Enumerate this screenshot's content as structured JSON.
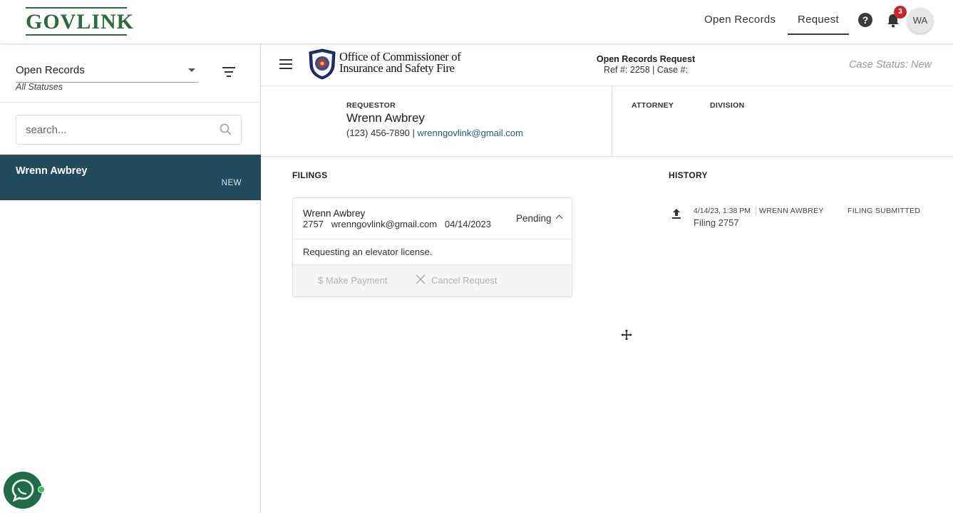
{
  "header": {
    "logo_text": "GOVLINK",
    "nav": [
      {
        "label": "Open Records"
      },
      {
        "label": "Request"
      }
    ],
    "help_icon": "help-circle-icon",
    "notifications": {
      "icon": "bell-icon",
      "count": "3"
    },
    "avatar_initials": "WA"
  },
  "sidebar": {
    "status_select": {
      "value": "Open Records",
      "sub": "All Statuses"
    },
    "search_placeholder": "search...",
    "cases": [
      {
        "name": "Wrenn Awbrey",
        "status": "NEW"
      }
    ]
  },
  "subheader": {
    "office_line1": "Office of Commissioner of",
    "office_line2": "Insurance and Safety Fire",
    "request_title": "Open Records Request",
    "request_ref": "Ref #: 2258 | Case #:",
    "case_status": "Case Status: New"
  },
  "requestor": {
    "label": "REQUESTOR",
    "name": "Wrenn Awbrey",
    "phone": "(123) 456-7890",
    "email": "wrenngovlink@gmail.com",
    "attorney_label": "ATTORNEY",
    "division_label": "DIVISION"
  },
  "filings": {
    "label": "FILINGS",
    "items": [
      {
        "name": "Wrenn Awbrey",
        "id": "2757",
        "email": "wrenngovlink@gmail.com",
        "date": "04/14/2023",
        "state": "Pending",
        "description": "Requesting an elevator license.",
        "make_payment": "$ Make Payment",
        "cancel_request": "Cancel Request"
      }
    ]
  },
  "history": {
    "label": "HISTORY",
    "items": [
      {
        "date": "4/14/23, 1:38 PM",
        "user": "WRENN AWBREY",
        "event": "FILING SUBMITTED",
        "filing": "Filing 2757"
      }
    ]
  },
  "colors": {
    "brand_green": "#2e6b3c",
    "selected_case_bg": "#234b5e",
    "link_blue": "#1f5c8a",
    "badge_red": "#c62828"
  }
}
